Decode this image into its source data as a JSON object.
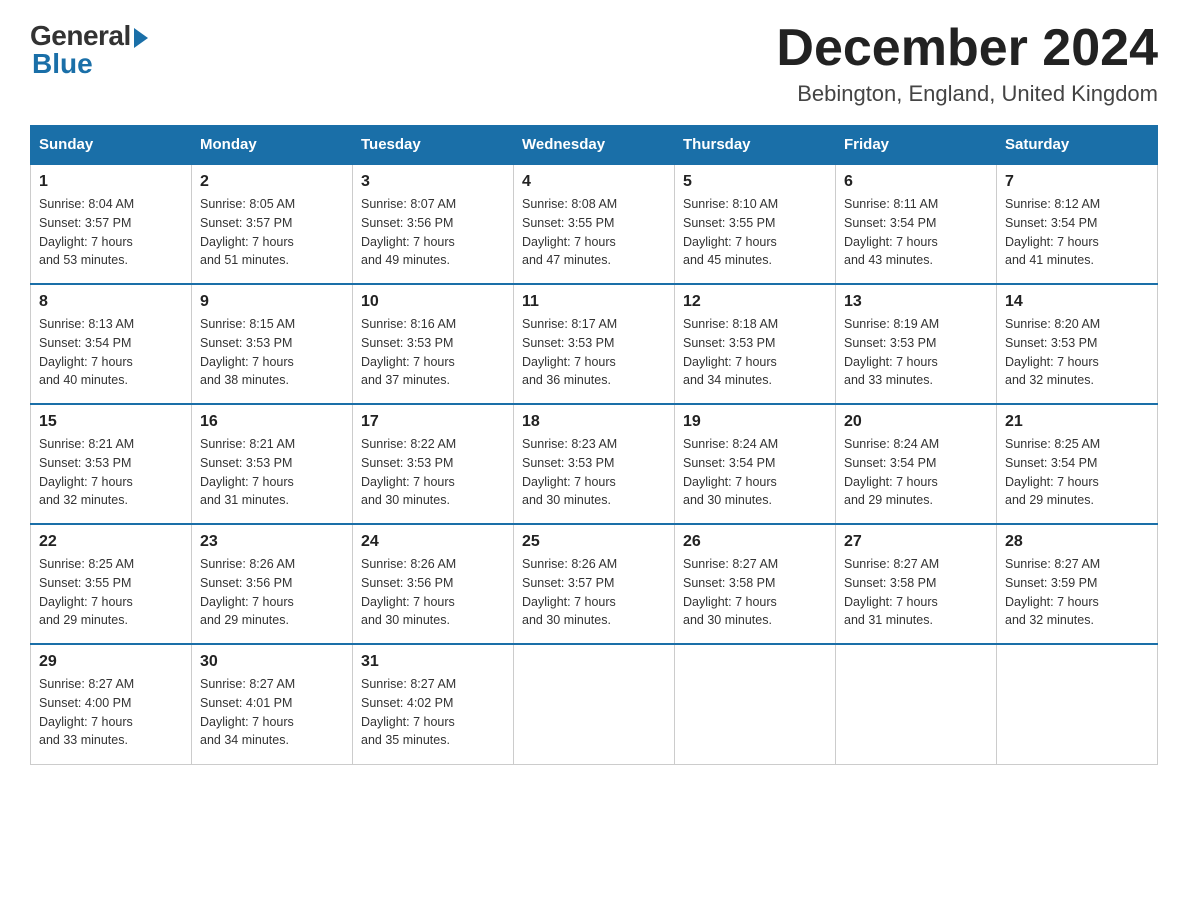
{
  "header": {
    "logo_general": "General",
    "logo_blue": "Blue",
    "month_title": "December 2024",
    "location": "Bebington, England, United Kingdom"
  },
  "days_of_week": [
    "Sunday",
    "Monday",
    "Tuesday",
    "Wednesday",
    "Thursday",
    "Friday",
    "Saturday"
  ],
  "weeks": [
    [
      {
        "day": "1",
        "sunrise": "8:04 AM",
        "sunset": "3:57 PM",
        "daylight": "7 hours and 53 minutes."
      },
      {
        "day": "2",
        "sunrise": "8:05 AM",
        "sunset": "3:57 PM",
        "daylight": "7 hours and 51 minutes."
      },
      {
        "day": "3",
        "sunrise": "8:07 AM",
        "sunset": "3:56 PM",
        "daylight": "7 hours and 49 minutes."
      },
      {
        "day": "4",
        "sunrise": "8:08 AM",
        "sunset": "3:55 PM",
        "daylight": "7 hours and 47 minutes."
      },
      {
        "day": "5",
        "sunrise": "8:10 AM",
        "sunset": "3:55 PM",
        "daylight": "7 hours and 45 minutes."
      },
      {
        "day": "6",
        "sunrise": "8:11 AM",
        "sunset": "3:54 PM",
        "daylight": "7 hours and 43 minutes."
      },
      {
        "day": "7",
        "sunrise": "8:12 AM",
        "sunset": "3:54 PM",
        "daylight": "7 hours and 41 minutes."
      }
    ],
    [
      {
        "day": "8",
        "sunrise": "8:13 AM",
        "sunset": "3:54 PM",
        "daylight": "7 hours and 40 minutes."
      },
      {
        "day": "9",
        "sunrise": "8:15 AM",
        "sunset": "3:53 PM",
        "daylight": "7 hours and 38 minutes."
      },
      {
        "day": "10",
        "sunrise": "8:16 AM",
        "sunset": "3:53 PM",
        "daylight": "7 hours and 37 minutes."
      },
      {
        "day": "11",
        "sunrise": "8:17 AM",
        "sunset": "3:53 PM",
        "daylight": "7 hours and 36 minutes."
      },
      {
        "day": "12",
        "sunrise": "8:18 AM",
        "sunset": "3:53 PM",
        "daylight": "7 hours and 34 minutes."
      },
      {
        "day": "13",
        "sunrise": "8:19 AM",
        "sunset": "3:53 PM",
        "daylight": "7 hours and 33 minutes."
      },
      {
        "day": "14",
        "sunrise": "8:20 AM",
        "sunset": "3:53 PM",
        "daylight": "7 hours and 32 minutes."
      }
    ],
    [
      {
        "day": "15",
        "sunrise": "8:21 AM",
        "sunset": "3:53 PM",
        "daylight": "7 hours and 32 minutes."
      },
      {
        "day": "16",
        "sunrise": "8:21 AM",
        "sunset": "3:53 PM",
        "daylight": "7 hours and 31 minutes."
      },
      {
        "day": "17",
        "sunrise": "8:22 AM",
        "sunset": "3:53 PM",
        "daylight": "7 hours and 30 minutes."
      },
      {
        "day": "18",
        "sunrise": "8:23 AM",
        "sunset": "3:53 PM",
        "daylight": "7 hours and 30 minutes."
      },
      {
        "day": "19",
        "sunrise": "8:24 AM",
        "sunset": "3:54 PM",
        "daylight": "7 hours and 30 minutes."
      },
      {
        "day": "20",
        "sunrise": "8:24 AM",
        "sunset": "3:54 PM",
        "daylight": "7 hours and 29 minutes."
      },
      {
        "day": "21",
        "sunrise": "8:25 AM",
        "sunset": "3:54 PM",
        "daylight": "7 hours and 29 minutes."
      }
    ],
    [
      {
        "day": "22",
        "sunrise": "8:25 AM",
        "sunset": "3:55 PM",
        "daylight": "7 hours and 29 minutes."
      },
      {
        "day": "23",
        "sunrise": "8:26 AM",
        "sunset": "3:56 PM",
        "daylight": "7 hours and 29 minutes."
      },
      {
        "day": "24",
        "sunrise": "8:26 AM",
        "sunset": "3:56 PM",
        "daylight": "7 hours and 30 minutes."
      },
      {
        "day": "25",
        "sunrise": "8:26 AM",
        "sunset": "3:57 PM",
        "daylight": "7 hours and 30 minutes."
      },
      {
        "day": "26",
        "sunrise": "8:27 AM",
        "sunset": "3:58 PM",
        "daylight": "7 hours and 30 minutes."
      },
      {
        "day": "27",
        "sunrise": "8:27 AM",
        "sunset": "3:58 PM",
        "daylight": "7 hours and 31 minutes."
      },
      {
        "day": "28",
        "sunrise": "8:27 AM",
        "sunset": "3:59 PM",
        "daylight": "7 hours and 32 minutes."
      }
    ],
    [
      {
        "day": "29",
        "sunrise": "8:27 AM",
        "sunset": "4:00 PM",
        "daylight": "7 hours and 33 minutes."
      },
      {
        "day": "30",
        "sunrise": "8:27 AM",
        "sunset": "4:01 PM",
        "daylight": "7 hours and 34 minutes."
      },
      {
        "day": "31",
        "sunrise": "8:27 AM",
        "sunset": "4:02 PM",
        "daylight": "7 hours and 35 minutes."
      },
      null,
      null,
      null,
      null
    ]
  ],
  "labels": {
    "sunrise": "Sunrise:",
    "sunset": "Sunset:",
    "daylight": "Daylight:"
  }
}
